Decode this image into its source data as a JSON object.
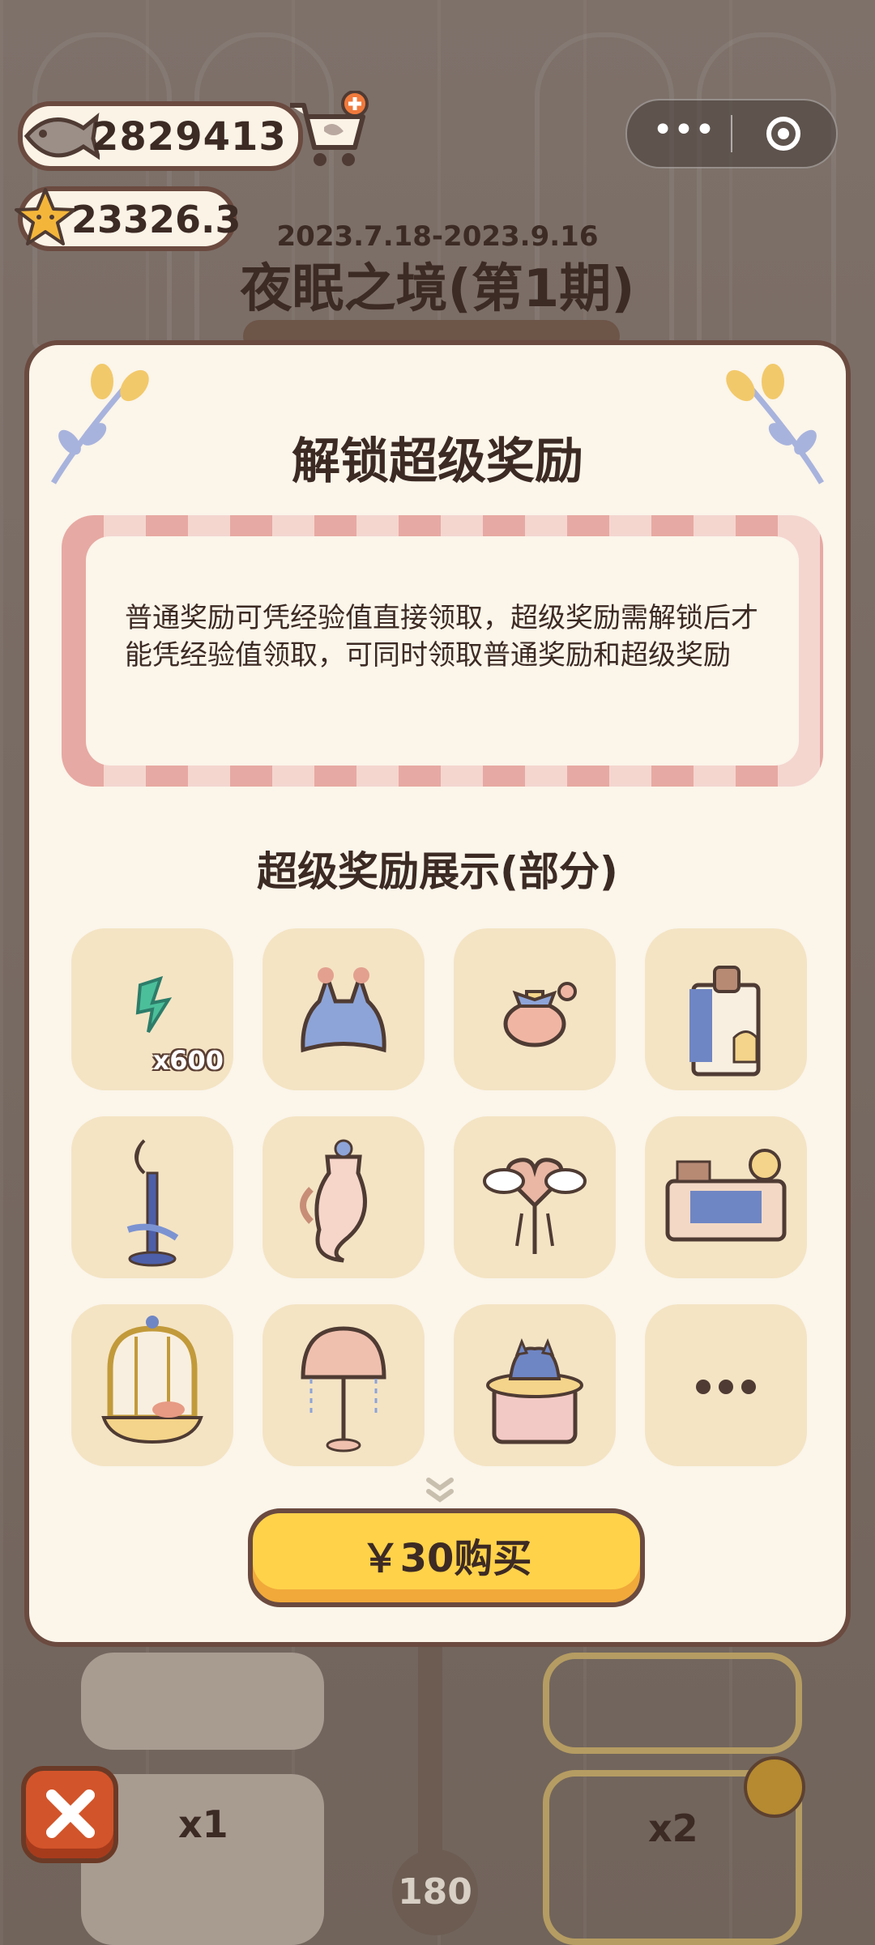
{
  "hud": {
    "fish_count": "2829413",
    "star_count": "23326.3"
  },
  "event": {
    "date_range": "2023.7.18-2023.9.16",
    "title": "夜眠之境(第1期)"
  },
  "modal": {
    "title": "解锁超级奖励",
    "description": "普通奖励可凭经验值直接领取，超级奖励需解锁后才能凭经验值领取，可同时领取普通奖励和超级奖励",
    "showcase_title": "超级奖励展示(部分)",
    "items": [
      {
        "name": "green-gem",
        "qty": "x600"
      },
      {
        "name": "blue-outfit"
      },
      {
        "name": "perfume-bottle"
      },
      {
        "name": "cabinet-with-cat"
      },
      {
        "name": "moon-lamp"
      },
      {
        "name": "dragon-vase"
      },
      {
        "name": "heart-clock"
      },
      {
        "name": "bedroom-set"
      },
      {
        "name": "golden-cage"
      },
      {
        "name": "jellyfish-lamp"
      },
      {
        "name": "cat-table"
      },
      {
        "name": "more"
      }
    ],
    "buy_label": "￥30购买"
  },
  "bottom": {
    "progress_value": "180",
    "reward_left_qty": "x1",
    "reward_right_qty": "x2"
  },
  "colors": {
    "accent": "#ffd24a",
    "border": "#6b4a3f",
    "panel": "#fbf5ea",
    "tile": "#f4e4c4"
  }
}
